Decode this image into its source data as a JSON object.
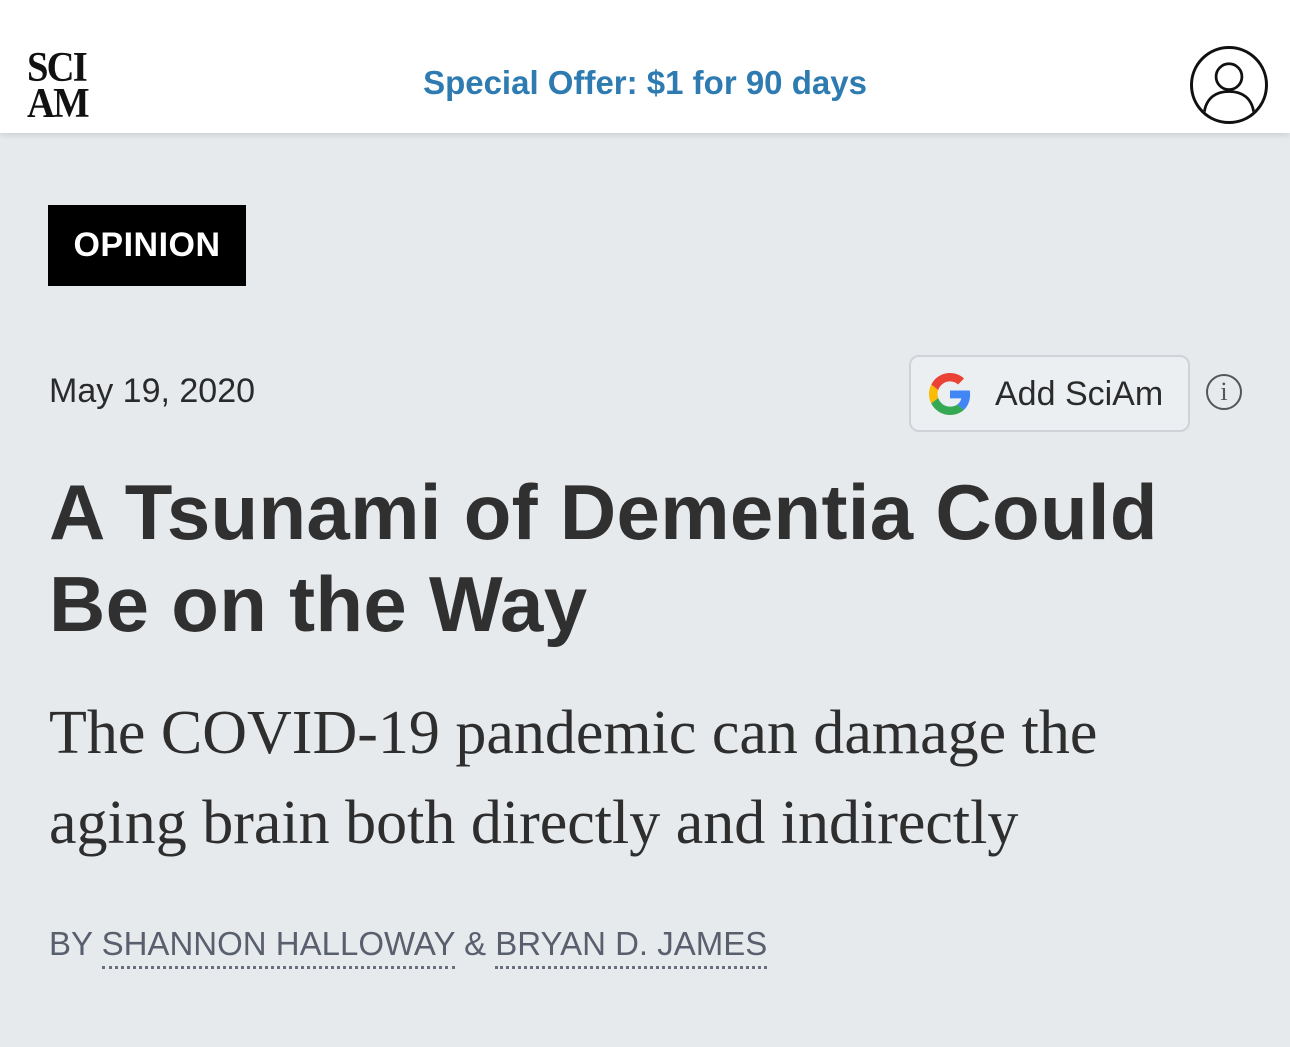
{
  "header": {
    "logo_line1": "SCI",
    "logo_line2": "AM",
    "offer_text": "Special Offer: $1 for 90 days",
    "account_icon": "user-icon"
  },
  "article": {
    "category": "OPINION",
    "date": "May 19, 2020",
    "add_button_label": "Add SciAm",
    "add_button_icon": "google-icon",
    "info_icon": "i",
    "headline": "A Tsunami of Dementia Could Be on the Way",
    "subheadline": "The COVID-19 pandemic can damage the aging brain both directly and indirectly",
    "byline": {
      "prefix": "BY ",
      "author1": "SHANNON HALLOWAY",
      "separator": " & ",
      "author2": "BRYAN D. JAMES"
    }
  },
  "colors": {
    "offer": "#2d7bb1",
    "background": "#e7eaed",
    "badge_bg": "#000000",
    "headline": "#303030",
    "byline": "#5a5f6e"
  }
}
